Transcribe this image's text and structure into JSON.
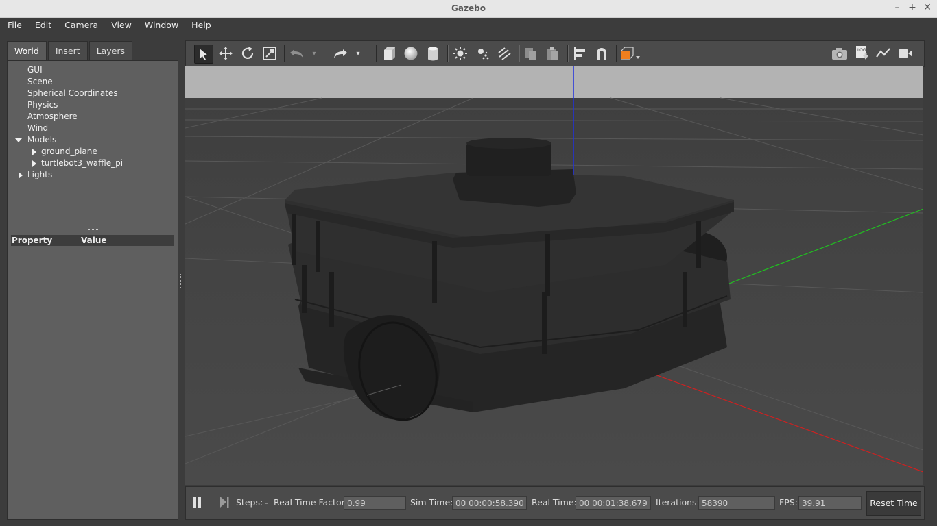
{
  "window": {
    "title": "Gazebo"
  },
  "menu": [
    "File",
    "Edit",
    "Camera",
    "View",
    "Window",
    "Help"
  ],
  "left_tabs": [
    "World",
    "Insert",
    "Layers"
  ],
  "tree": {
    "gui": "GUI",
    "scene": "Scene",
    "spherical": "Spherical Coordinates",
    "physics": "Physics",
    "atmosphere": "Atmosphere",
    "wind": "Wind",
    "models": "Models",
    "ground_plane": "ground_plane",
    "turtlebot": "turtlebot3_waffle_pi",
    "lights": "Lights"
  },
  "properties": {
    "col_property": "Property",
    "col_value": "Value"
  },
  "toolbar_icons": [
    "select-arrow-icon",
    "translate-icon",
    "rotate-icon",
    "scale-icon",
    "undo-icon",
    "undo-dropdown-icon",
    "redo-icon",
    "redo-dropdown-icon",
    "box-icon",
    "sphere-icon",
    "cylinder-icon",
    "point-light-icon",
    "spot-light-icon",
    "directional-light-icon",
    "copy-icon",
    "paste-icon",
    "align-icon",
    "snap-icon",
    "view-angle-icon",
    "screenshot-icon",
    "log-icon",
    "plot-icon",
    "video-record-icon"
  ],
  "status": {
    "steps_label": "Steps:",
    "rtf_label": "Real Time Factor:",
    "rtf_value": "0.99",
    "simtime_label": "Sim Time:",
    "simtime_value": "00 00:00:58.390",
    "realtime_label": "Real Time:",
    "realtime_value": "00 00:01:38.679",
    "iter_label": "Iterations:",
    "iter_value": "58390",
    "fps_label": "FPS:",
    "fps_value": "39.91",
    "reset_label": "Reset Time"
  },
  "colors": {
    "x_axis": "#d02020",
    "y_axis": "#20c020",
    "z_axis": "#2030e0",
    "sky": "#b3b3b3",
    "ground": "#474747"
  }
}
